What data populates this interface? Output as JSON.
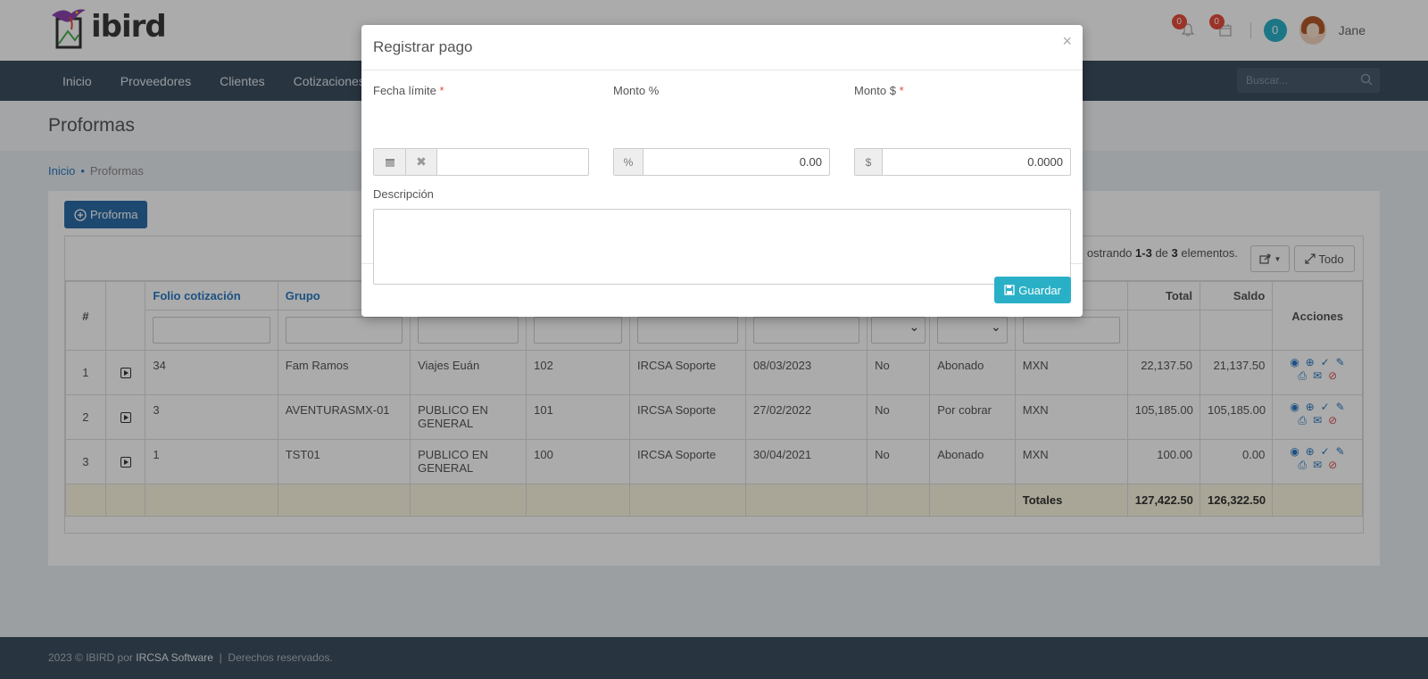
{
  "header": {
    "logo_text": "ibird",
    "notifications_count": "0",
    "calendar_count": "0",
    "messages_count": "0",
    "user_name": "Jane"
  },
  "nav": {
    "items": [
      "Inicio",
      "Proveedores",
      "Clientes",
      "Cotizaciones"
    ],
    "search_placeholder": "Buscar..."
  },
  "page": {
    "title": "Proformas",
    "breadcrumb": {
      "home": "Inicio",
      "current": "Proformas"
    }
  },
  "panel": {
    "add_button": "Proforma",
    "summary": {
      "prefix": "ostrando",
      "range": "1-3",
      "of": "de",
      "total": "3",
      "suffix": "elementos."
    },
    "all_button": "Todo"
  },
  "table": {
    "headers": {
      "num": "#",
      "folio": "Folio cotización",
      "grupo": "Grupo",
      "total": "Total",
      "saldo": "Saldo",
      "acciones": "Acciones"
    },
    "rows": [
      {
        "n": "1",
        "folio": "34",
        "grupo": "Fam Ramos",
        "cliente": "Viajes Euán",
        "num": "102",
        "agente": "IRCSA Soporte",
        "fecha": "08/03/2023",
        "flag": "No",
        "estado": "Abonado",
        "moneda": "MXN",
        "total": "22,137.50",
        "saldo": "21,137.50"
      },
      {
        "n": "2",
        "folio": "3",
        "grupo": "AVENTURASMX-01",
        "cliente": "PUBLICO EN GENERAL",
        "num": "101",
        "agente": "IRCSA Soporte",
        "fecha": "27/02/2022",
        "flag": "No",
        "estado": "Por cobrar",
        "moneda": "MXN",
        "total": "105,185.00",
        "saldo": "105,185.00"
      },
      {
        "n": "3",
        "folio": "1",
        "grupo": "TST01",
        "cliente": "PUBLICO EN GENERAL",
        "num": "100",
        "agente": "IRCSA Soporte",
        "fecha": "30/04/2021",
        "flag": "No",
        "estado": "Abonado",
        "moneda": "MXN",
        "total": "100.00",
        "saldo": "0.00"
      }
    ],
    "totals": {
      "label": "Totales",
      "total": "127,422.50",
      "saldo": "126,322.50"
    }
  },
  "footer": {
    "year_text": "2023 © IBIRD por",
    "company": "IRCSA Software",
    "separator": "|",
    "rights": "Derechos reservados."
  },
  "modal": {
    "title": "Registrar pago",
    "close": "×",
    "fecha_label": "Fecha límite",
    "monto_pct_label": "Monto %",
    "pct_addon": "%",
    "monto_pct_value": "0.00",
    "monto_usd_label": "Monto $",
    "usd_addon": "$",
    "monto_usd_value": "0.0000",
    "descripcion_label": "Descripción",
    "required_mark": "*",
    "save_button": "Guardar"
  },
  "colors": {
    "nav_bg": "#3d4e5f",
    "primary": "#2c6ca8",
    "info": "#2ab0c6",
    "danger": "#e74c3c",
    "totals_bg": "#fcf8e3"
  }
}
